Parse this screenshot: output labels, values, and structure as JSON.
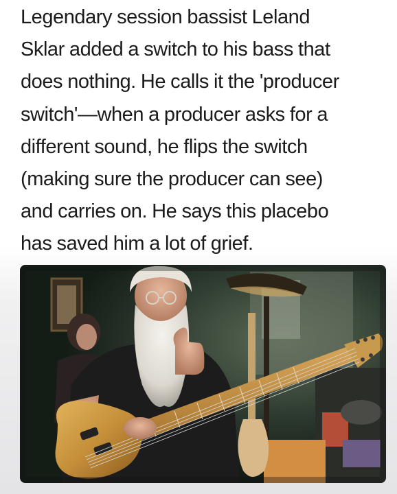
{
  "post": {
    "caption_lines": [
      "Legendary session bassist Leland",
      "Sklar added a switch to his bass that",
      "does nothing. He calls it the 'producer",
      "switch'—when a producer asks for a",
      "different sound, he flips the switch",
      "(making sure the producer can see)",
      "and carries on. He says this placebo",
      "has saved him a lot of grief."
    ]
  },
  "photo": {
    "subject": "bearded bassist giving thumbs up with a natural-finish bass guitar",
    "colors": {
      "background": "#1d2a22",
      "beard": "#e9e6df",
      "bass_body": "#c9953f",
      "shirt": "#1a1a1a"
    }
  }
}
